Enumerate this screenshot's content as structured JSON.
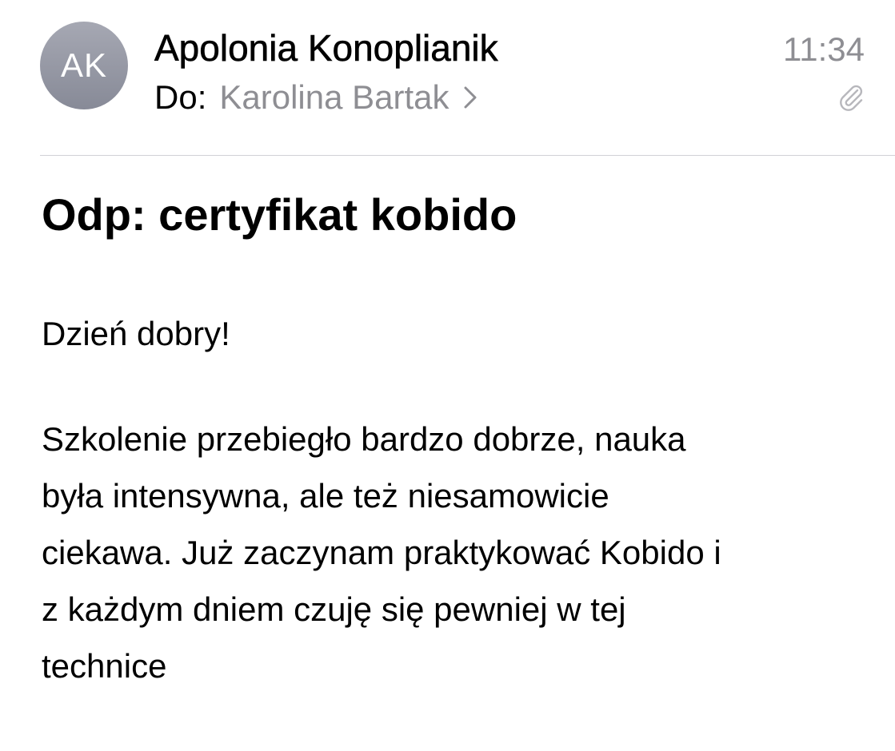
{
  "header": {
    "avatar_initials": "AK",
    "sender_name": "Apolonia Konoplianik",
    "time": "11:34",
    "to_label": "Do:",
    "recipient": "Karolina Bartak",
    "icons": [
      "chevron-right-icon",
      "paperclip-icon"
    ]
  },
  "message": {
    "subject": "Odp: certyfikat kobido",
    "greeting": "Dzień dobry!",
    "body_lines": [
      "Szkolenie przebiegło bardzo dobrze, nauka",
      "była intensywna, ale też niesamowicie",
      "ciekawa. Już zaczynam praktykować Kobido i",
      "z każdym dniem czuję się pewniej w tej",
      "technice"
    ]
  },
  "colors": {
    "secondary_text": "#8e8e93",
    "avatar_bg": "#979aa6",
    "divider": "#d1d1d6"
  }
}
